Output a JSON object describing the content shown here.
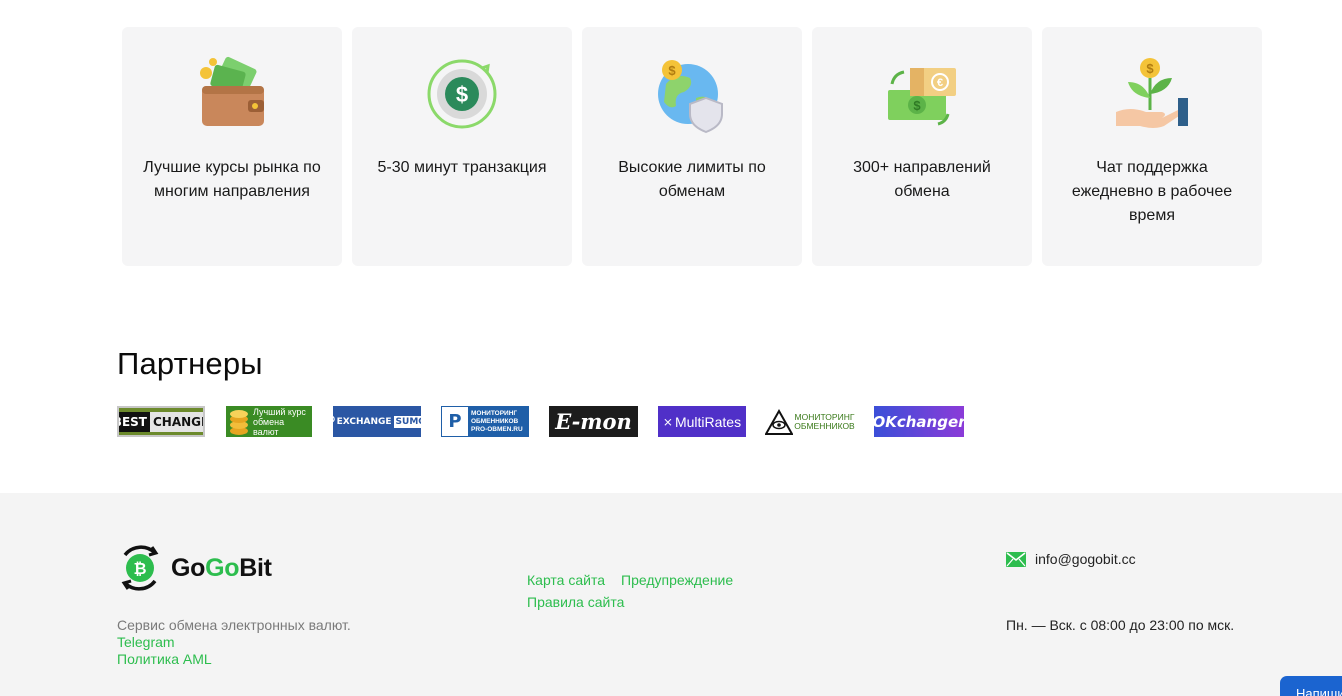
{
  "features": [
    {
      "icon": "wallet-money-icon",
      "text": "Лучшие курсы рынка по многим направления"
    },
    {
      "icon": "dollar-cycle-icon",
      "text": "5-30 минут транзакция"
    },
    {
      "icon": "globe-shield-icon",
      "text": "Высокие лимиты по обменам"
    },
    {
      "icon": "cash-exchange-icon",
      "text": "300+ направлений обмена"
    },
    {
      "icon": "hand-plant-coin-icon",
      "text": "Чат поддержка ежедневно в рабочее время"
    }
  ],
  "partners": {
    "title": "Партнеры",
    "logos": [
      {
        "name": "BEST CHANGE",
        "part1": "BEST",
        "part2": "CHANGE"
      },
      {
        "name": "Лучший курс обмена валют",
        "line1": "Лучший курс",
        "line2": "обмена валют"
      },
      {
        "name": "EXCHANGE SUMO",
        "part1": "EXCHANGE",
        "part2": "SUMO"
      },
      {
        "name": "Мониторинг обменников PRO-OBMEN.RU",
        "line1": "МОНИТОРИНГ",
        "line2": "ОБМЕННИКОВ",
        "line3": "PRO-OBMEN.RU"
      },
      {
        "name": "E-mon",
        "text": "E-mon"
      },
      {
        "name": "MultiRates",
        "text": "MultiRates"
      },
      {
        "name": "Мониторинг обменников",
        "line1": "МОНИТОРИНГ",
        "line2": "ОБМЕННИКОВ"
      },
      {
        "name": "OKchanger",
        "text": "OKchanger"
      }
    ]
  },
  "footer": {
    "logo_part1": "Go",
    "logo_part2": "Go",
    "logo_part3": "Bit",
    "description": "Сервис обмена электронных валют.",
    "telegram": "Telegram",
    "aml": "Политика AML",
    "nav": [
      "Карта сайта",
      "Предупреждение",
      "Правила сайта"
    ],
    "email": "info@gogobit.cc",
    "hours": "Пн. — Вск. с 08:00 до 23:00 по мск."
  },
  "chat_button": {
    "label": "Напишите нам"
  },
  "colors": {
    "accent": "#2dbd4e",
    "card_bg": "#f5f5f6",
    "footer_bg": "#f4f4f4",
    "chat_blue": "#1b64d0"
  }
}
